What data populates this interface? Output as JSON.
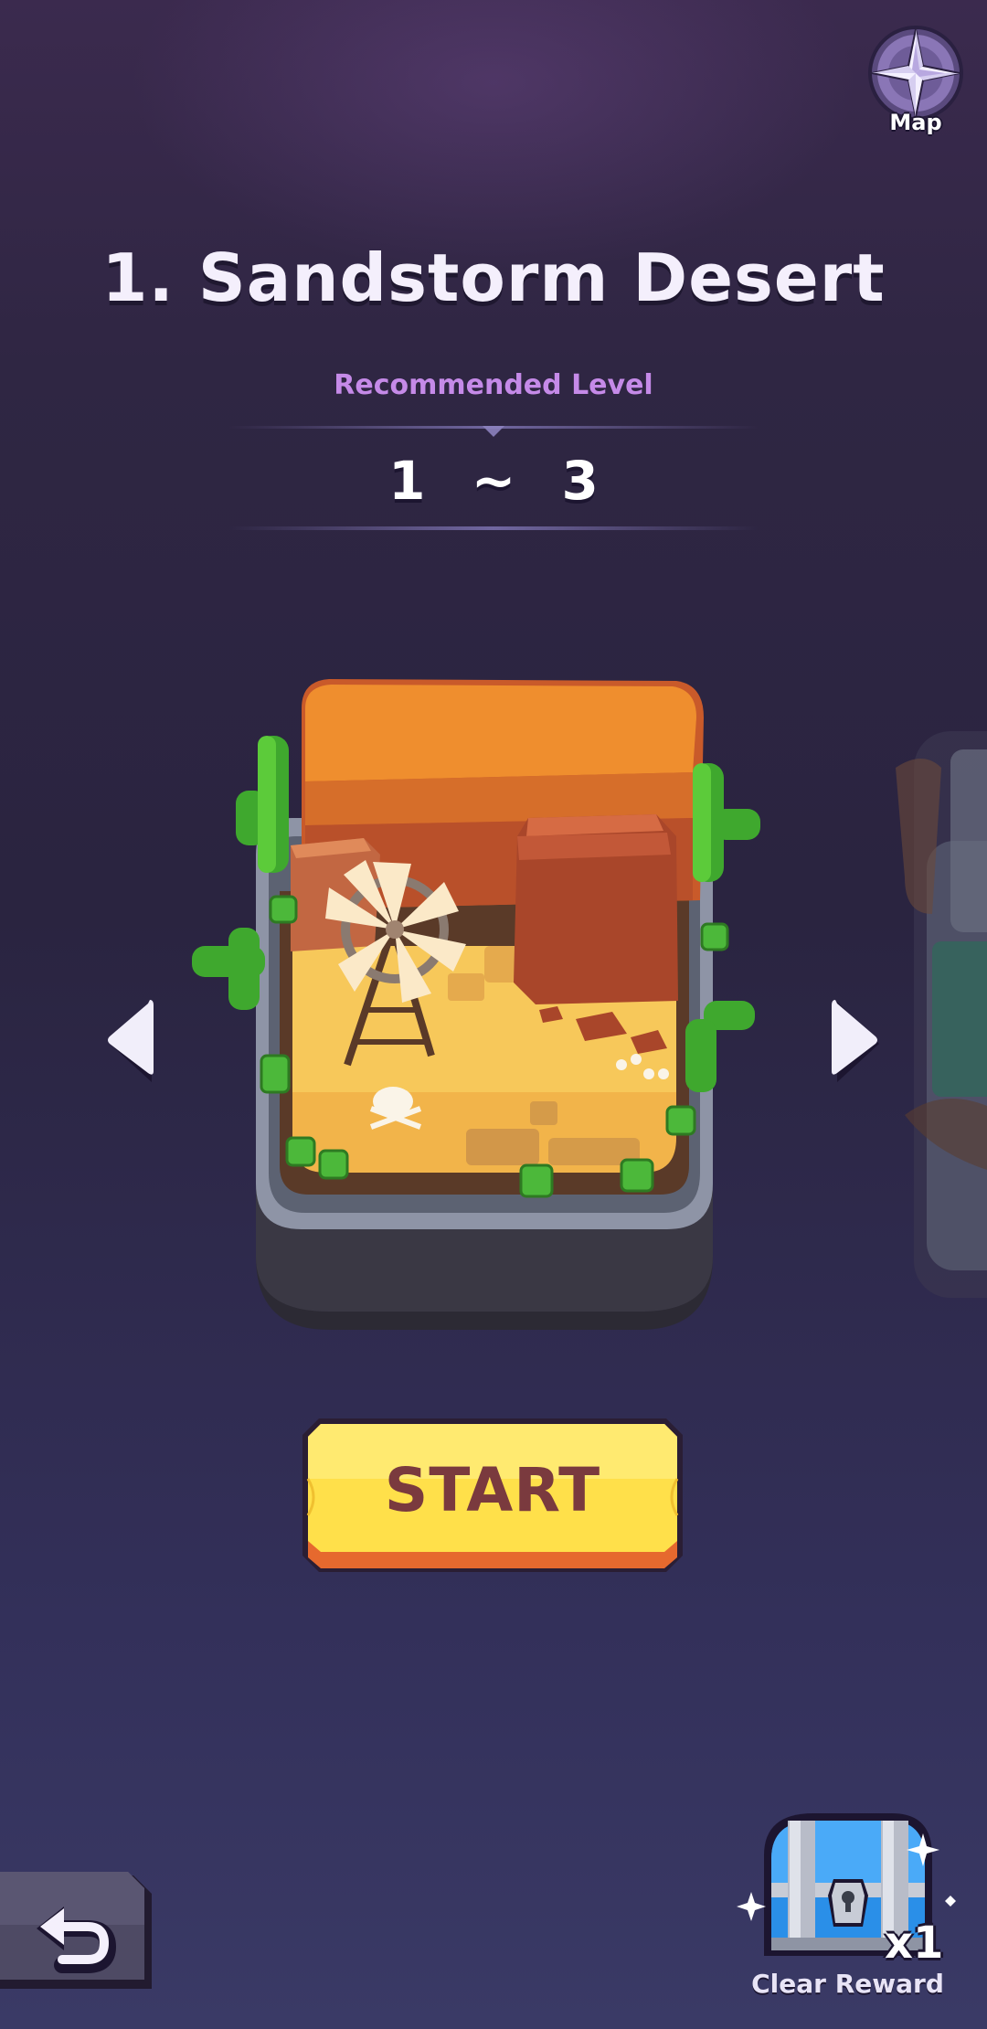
{
  "header": {
    "map_label": "Map",
    "map_icon": "compass-icon"
  },
  "stage": {
    "title": "1. Sandstorm Desert",
    "recommended_label": "Recommended Level",
    "level_range": "1 ~ 3"
  },
  "navigation": {
    "prev_icon": "chevron-left-icon",
    "next_icon": "chevron-right-icon"
  },
  "actions": {
    "start_label": "START",
    "back_icon": "undo-arrow-icon"
  },
  "reward": {
    "label": "Clear Reward",
    "count": "x1",
    "icon": "treasure-chest-icon"
  },
  "colors": {
    "title_text": "#f4effc",
    "recommended_text": "#c58ae8",
    "start_button": "#ffe04a",
    "start_text": "#7a3a3e",
    "background_top": "#3b2a4e",
    "background_bottom": "#3a3a66"
  }
}
